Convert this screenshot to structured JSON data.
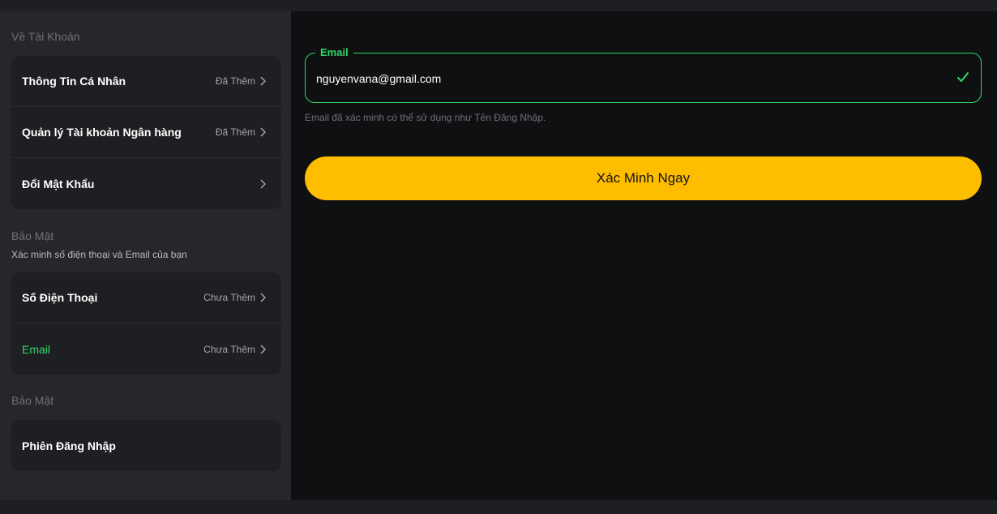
{
  "sidebar": {
    "account_section": {
      "title": "Về Tài Khoản",
      "items": [
        {
          "label": "Thông Tin Cá Nhân",
          "status": "Đã Thêm"
        },
        {
          "label": "Quản lý Tài khoản Ngân hàng",
          "status": "Đã Thêm"
        },
        {
          "label": "Đổi Mật Khẩu",
          "status": ""
        }
      ]
    },
    "security_section": {
      "title": "Bảo Mật",
      "subtitle": "Xác minh số điện thoại và Email của bạn",
      "items": [
        {
          "label": "Số Điện Thoại",
          "status": "Chưa Thêm"
        },
        {
          "label": "Email",
          "status": "Chưa Thêm",
          "active": true
        }
      ]
    },
    "session_section": {
      "title": "Bảo Mật",
      "items": [
        {
          "label": "Phiên Đăng Nhập"
        }
      ]
    }
  },
  "main": {
    "email_field": {
      "label": "Email",
      "value": "nguyenvana@gmail.com",
      "valid": true
    },
    "helper_text": "Email đã xác minh có thể sử dụng như Tên Đăng Nhập.",
    "verify_button": "Xác Minh Ngay"
  },
  "colors": {
    "accent_green": "#2fd76a",
    "button_yellow": "#ffbd00",
    "sidebar_bg": "#26272b",
    "main_bg": "#0f1012"
  },
  "icons": [
    "chevron-right-icon",
    "check-icon"
  ]
}
